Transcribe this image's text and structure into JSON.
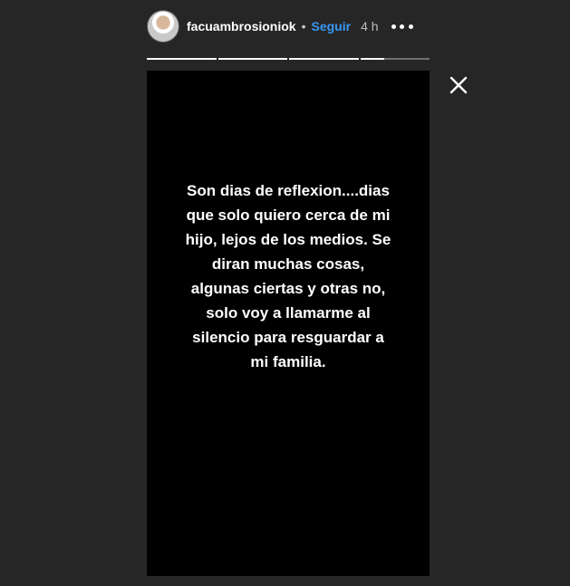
{
  "header": {
    "username": "facuambrosioniok",
    "separator": "•",
    "follow_label": "Seguir",
    "time": "4 h",
    "more_icon": "more-horizontal-icon"
  },
  "progress": {
    "segments": [
      {
        "fill": 1.0
      },
      {
        "fill": 1.0
      },
      {
        "fill": 1.0
      },
      {
        "fill": 0.35
      }
    ]
  },
  "close_icon": "close-icon",
  "story": {
    "text": "Son dias de reflexion....dias que solo quiero cerca de mi hijo, lejos de los medios. Se diran muchas cosas, algunas ciertas y otras no, solo voy a llamarme al silencio para resguardar a mi familia."
  }
}
